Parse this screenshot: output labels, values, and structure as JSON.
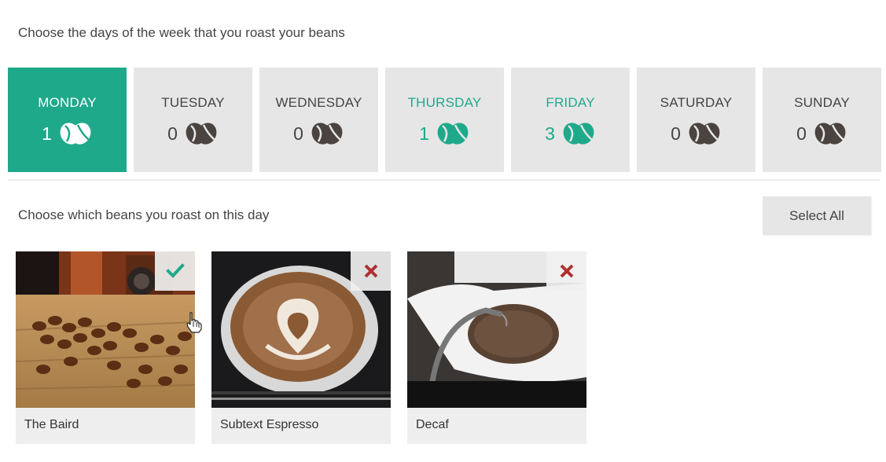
{
  "days_section": {
    "title": "Choose the days of the week that you roast your beans",
    "days": [
      {
        "name": "MONDAY",
        "count": "1",
        "state": "active"
      },
      {
        "name": "TUESDAY",
        "count": "0",
        "state": "none"
      },
      {
        "name": "WEDNESDAY",
        "count": "0",
        "state": "none"
      },
      {
        "name": "THURSDAY",
        "count": "1",
        "state": "partial"
      },
      {
        "name": "FRIDAY",
        "count": "3",
        "state": "partial"
      },
      {
        "name": "SATURDAY",
        "count": "0",
        "state": "none"
      },
      {
        "name": "SUNDAY",
        "count": "0",
        "state": "none"
      }
    ]
  },
  "beans_section": {
    "title": "Choose which beans you roast on this day",
    "select_all_label": "Select All",
    "beans": [
      {
        "name": "The Baird",
        "selected": true,
        "badge_icon": "check-icon"
      },
      {
        "name": "Subtext Espresso",
        "selected": false,
        "badge_icon": "close-icon"
      },
      {
        "name": "Decaf",
        "selected": false,
        "badge_icon": "close-icon"
      }
    ]
  },
  "colors": {
    "accent": "#1fa98b",
    "card_bg": "#e6e6e6",
    "deselect": "#b03030",
    "bean_icon_dark": "#4a4340"
  }
}
